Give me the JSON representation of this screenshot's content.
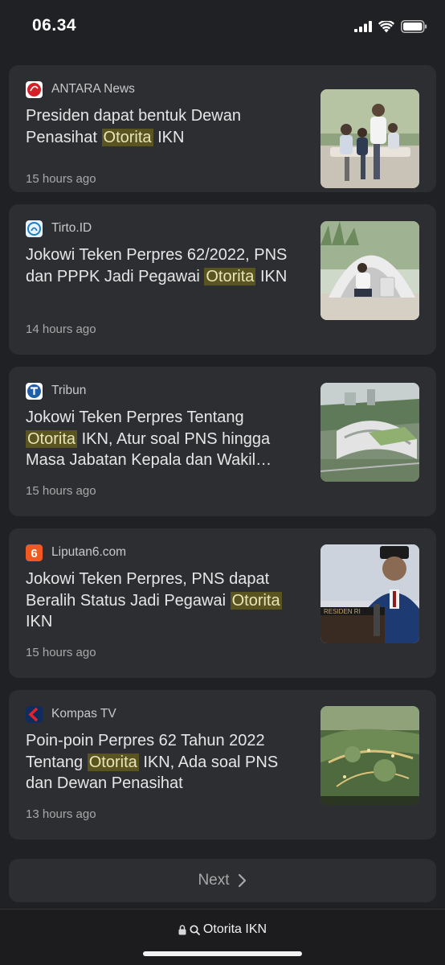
{
  "status_bar": {
    "time": "06.34"
  },
  "articles": [
    {
      "source": "ANTARA News",
      "headline_before": "Presiden dapat bentuk Dewan Penasihat ",
      "highlight": "Otorita",
      "headline_after": " IKN",
      "time": "15 hours ago",
      "favicon_icon": "antara-logo-icon",
      "thumbnail_icon": "family-photo-thumbnail"
    },
    {
      "source": "Tirto.ID",
      "headline_before": "Jokowi Teken Perpres 62/2022, PNS dan PPPK Jadi Pegawai ",
      "highlight": "Otorita",
      "headline_after": " IKN",
      "time": "14 hours ago",
      "favicon_icon": "tirto-logo-icon",
      "thumbnail_icon": "tent-photo-thumbnail"
    },
    {
      "source": "Tribun",
      "headline_before": "Jokowi Teken Perpres Tentang ",
      "highlight": "Otorita",
      "headline_after": " IKN, Atur soal PNS hingga Masa Jabatan Kepala dan Wakil…",
      "time": "15 hours ago",
      "favicon_icon": "tribun-logo-icon",
      "thumbnail_icon": "building-render-thumbnail"
    },
    {
      "source": "Liputan6.com",
      "headline_before": "Jokowi Teken Perpres, PNS dapat Beralih Status Jadi Pegawai ",
      "highlight": "Otorita",
      "headline_after": " IKN",
      "time": "15 hours ago",
      "favicon_icon": "liputan6-logo-icon",
      "thumbnail_icon": "president-photo-thumbnail"
    },
    {
      "source": "Kompas TV",
      "headline_before": "Poin-poin Perpres 62 Tahun 2022 Tentang ",
      "highlight": "Otorita",
      "headline_after": " IKN, Ada soal PNS dan Dewan Penasihat",
      "time": "13 hours ago",
      "favicon_icon": "kompas-tv-logo-icon",
      "thumbnail_icon": "city-aerial-thumbnail"
    }
  ],
  "pagination": {
    "next_label": "Next"
  },
  "address_bar": {
    "query": "Otorita IKN"
  },
  "colors": {
    "background": "#202124",
    "card": "#2d2e31",
    "highlight": "#5a5520"
  }
}
